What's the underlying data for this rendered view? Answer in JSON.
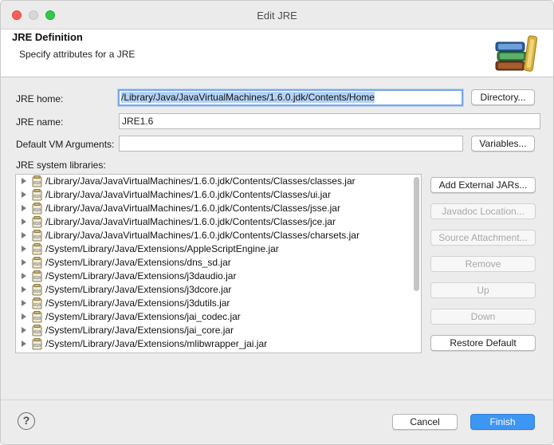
{
  "window": {
    "title": "Edit JRE"
  },
  "header": {
    "title": "JRE Definition",
    "subtitle": "Specify attributes for a JRE",
    "icon": "books-icon"
  },
  "form": {
    "jre_home_label": "JRE home:",
    "jre_home_value": "/Library/Java/JavaVirtualMachines/1.6.0.jdk/Contents/Home",
    "directory_button": "Directory...",
    "jre_name_label": "JRE name:",
    "jre_name_value": "JRE1.6",
    "vm_args_label": "Default VM Arguments:",
    "vm_args_value": "",
    "variables_button": "Variables...",
    "libraries_label": "JRE system libraries:"
  },
  "libraries": [
    "/Library/Java/JavaVirtualMachines/1.6.0.jdk/Contents/Classes/classes.jar",
    "/Library/Java/JavaVirtualMachines/1.6.0.jdk/Contents/Classes/ui.jar",
    "/Library/Java/JavaVirtualMachines/1.6.0.jdk/Contents/Classes/jsse.jar",
    "/Library/Java/JavaVirtualMachines/1.6.0.jdk/Contents/Classes/jce.jar",
    "/Library/Java/JavaVirtualMachines/1.6.0.jdk/Contents/Classes/charsets.jar",
    "/System/Library/Java/Extensions/AppleScriptEngine.jar",
    "/System/Library/Java/Extensions/dns_sd.jar",
    "/System/Library/Java/Extensions/j3daudio.jar",
    "/System/Library/Java/Extensions/j3dcore.jar",
    "/System/Library/Java/Extensions/j3dutils.jar",
    "/System/Library/Java/Extensions/jai_codec.jar",
    "/System/Library/Java/Extensions/jai_core.jar",
    "/System/Library/Java/Extensions/mlibwrapper_jai.jar"
  ],
  "side_buttons": {
    "add_external": "Add External JARs...",
    "javadoc": "Javadoc Location...",
    "source": "Source Attachment...",
    "remove": "Remove",
    "up": "Up",
    "down": "Down",
    "restore": "Restore Default"
  },
  "footer": {
    "help": "?",
    "cancel": "Cancel",
    "finish": "Finish"
  }
}
